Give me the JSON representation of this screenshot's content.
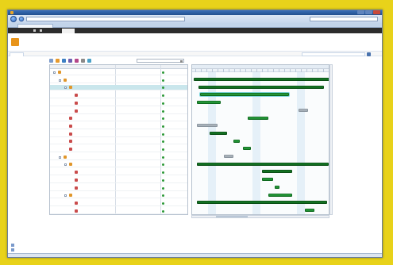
{
  "window": {
    "title": ""
  },
  "browser": {
    "url": "",
    "search_placeholder": "",
    "tab_label": ""
  },
  "ribbon": {
    "site_actions": "",
    "browse": "",
    "page": "",
    "user": ""
  },
  "site": {
    "title": "",
    "top_nav": [
      "",
      "",
      "",
      "",
      ""
    ],
    "search_placeholder": ""
  },
  "left_nav": {
    "sections": [
      {
        "heading": "",
        "items": [
          "",
          "",
          "",
          ""
        ]
      },
      {
        "heading": "",
        "items": [
          "",
          ""
        ]
      },
      {
        "heading": "",
        "items": [
          "",
          "",
          "",
          "",
          ""
        ]
      },
      {
        "heading": "",
        "items": [
          "",
          ""
        ]
      }
    ],
    "bottom": [
      "",
      ""
    ]
  },
  "content": {
    "title": "",
    "scale_value": "",
    "grid_columns": [
      "",
      "",
      ""
    ],
    "timeline_labels": [
      "",
      "",
      ""
    ],
    "rows": [
      {
        "level": 1,
        "icon": "task",
        "name": "",
        "assigned": "",
        "status": "",
        "status_color": "#2f9a3a"
      },
      {
        "level": 2,
        "icon": "task",
        "name": "",
        "assigned": "",
        "status": "",
        "status_color": "#2f9a3a"
      },
      {
        "level": 3,
        "icon": "task",
        "name": "",
        "assigned": "",
        "status": "",
        "status_color": "#2f9a3a",
        "selected": true
      },
      {
        "level": 4,
        "icon": "item",
        "name": "",
        "assigned": "",
        "status": "",
        "status_color": "#2f9a3a"
      },
      {
        "level": 4,
        "icon": "item",
        "name": "",
        "assigned": "",
        "status": "",
        "status_color": "#2f9a3a"
      },
      {
        "level": 4,
        "icon": "item",
        "name": "",
        "assigned": "",
        "status": "",
        "status_color": "#2f9a3a"
      },
      {
        "level": 3,
        "icon": "item",
        "name": "",
        "assigned": "",
        "status": "",
        "status_color": "#2f9a3a"
      },
      {
        "level": 3,
        "icon": "item",
        "name": "",
        "assigned": "",
        "status": "",
        "status_color": "#2f9a3a"
      },
      {
        "level": 3,
        "icon": "item",
        "name": "",
        "assigned": "",
        "status": "",
        "status_color": "#2f9a3a"
      },
      {
        "level": 3,
        "icon": "item",
        "name": "",
        "assigned": "",
        "status": "",
        "status_color": "#2f9a3a"
      },
      {
        "level": 3,
        "icon": "item",
        "name": "",
        "assigned": "",
        "status": "",
        "status_color": "#2f9a3a"
      },
      {
        "level": 2,
        "icon": "task",
        "name": "",
        "assigned": "",
        "status": "",
        "status_color": "#2f9a3a"
      },
      {
        "level": 3,
        "icon": "task",
        "name": "",
        "assigned": "",
        "status": "",
        "status_color": "#2f9a3a"
      },
      {
        "level": 4,
        "icon": "item",
        "name": "",
        "assigned": "",
        "status": "",
        "status_color": "#2f9a3a"
      },
      {
        "level": 4,
        "icon": "item",
        "name": "",
        "assigned": "",
        "status": "",
        "status_color": "#2f9a3a"
      },
      {
        "level": 4,
        "icon": "item",
        "name": "",
        "assigned": "",
        "status": "",
        "status_color": "#2f9a3a"
      },
      {
        "level": 3,
        "icon": "task",
        "name": "",
        "assigned": "",
        "status": "",
        "status_color": "#2f9a3a"
      },
      {
        "level": 4,
        "icon": "item",
        "name": "",
        "assigned": "",
        "status": "",
        "status_color": "#2f9a3a"
      },
      {
        "level": 4,
        "icon": "item",
        "name": "",
        "assigned": "",
        "status": "",
        "status_color": "#2f9a3a"
      }
    ]
  },
  "statusbar": {
    "text": ""
  },
  "colors": {
    "accent": "#2f5f9e",
    "bar_green": "#1f9a35",
    "bar_grey": "#a7b0b8",
    "row_highlight": "#c9e6ec"
  }
}
